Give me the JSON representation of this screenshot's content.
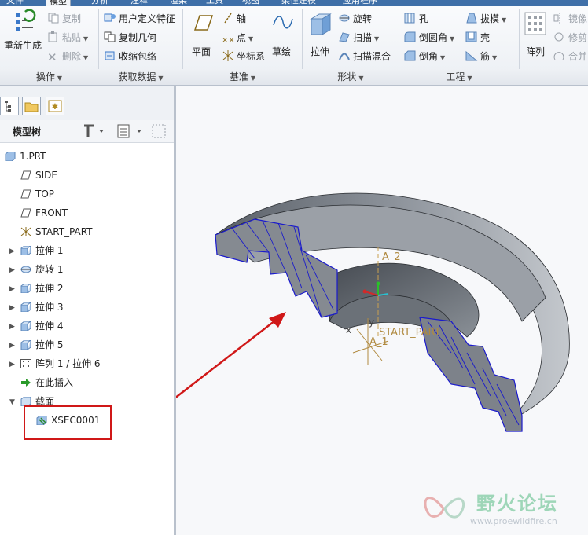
{
  "tabs": [
    "文件",
    "模型",
    "分析",
    "注释",
    "渲染",
    "工具",
    "视图",
    "柔性建模",
    "应用程序"
  ],
  "ribbon": {
    "operations": {
      "regenerate": "重新生成",
      "copy": "复制",
      "paste": "粘贴",
      "delete": "删除",
      "label": "操作"
    },
    "get_data": {
      "udf": "用户定义特征",
      "copy_geom": "复制几何",
      "shrinkwrap": "收缩包络",
      "label": "获取数据"
    },
    "datum": {
      "plane": "平面",
      "axis": "轴",
      "point": "点",
      "csys": "坐标系",
      "sketch": "草绘",
      "label": "基准"
    },
    "shapes": {
      "extrude": "拉伸",
      "revolve": "旋转",
      "sweep": "扫描",
      "swept_blend": "扫描混合",
      "label": "形状"
    },
    "engineering": {
      "hole": "孔",
      "round": "倒圆角",
      "chamfer": "倒角",
      "draft": "拔模",
      "shell": "壳",
      "rib": "筋",
      "label": "工程"
    },
    "editing": {
      "pattern": "阵列",
      "mirror": "镜像",
      "trim": "修剪",
      "merge": "合并"
    }
  },
  "model_tree": {
    "title": "模型树",
    "items": [
      {
        "label": "1.PRT"
      },
      {
        "label": "SIDE"
      },
      {
        "label": "TOP"
      },
      {
        "label": "FRONT"
      },
      {
        "label": "START_PART"
      },
      {
        "label": "拉伸 1"
      },
      {
        "label": "旋转 1"
      },
      {
        "label": "拉伸 2"
      },
      {
        "label": "拉伸 3"
      },
      {
        "label": "拉伸 4"
      },
      {
        "label": "拉伸 5"
      },
      {
        "label": "阵列 1 / 拉伸 6"
      },
      {
        "label": "在此插入"
      },
      {
        "label": "截面"
      },
      {
        "label": "XSEC0001"
      }
    ]
  },
  "graphics": {
    "axis_label": "A_2",
    "csys_label": "START_PART",
    "axis2_label": "A_1",
    "x_label": "x",
    "y_label": "y"
  },
  "watermark": {
    "name": "野火论坛",
    "url": "www.proewildfire.cn"
  },
  "colors": {
    "highlight": "#d01818",
    "section_edge": "#1a1acc",
    "part_fill": "#8a8f96"
  }
}
